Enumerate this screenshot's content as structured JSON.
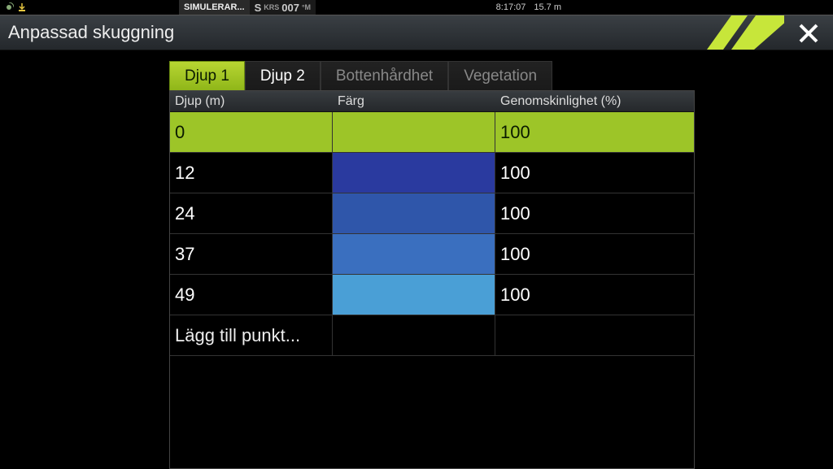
{
  "status": {
    "simulation_label": "SIMULERAR...",
    "heading_prefix": "S",
    "heading_label": "KRS",
    "heading_value": "007",
    "heading_unit": "°M",
    "time": "8:17:07",
    "depth": "15.7 m"
  },
  "title": "Anpassad skuggning",
  "accent_color": "#c7e63a",
  "tabs": [
    {
      "label": "Djup 1",
      "active": true
    },
    {
      "label": "Djup 2",
      "active": false
    },
    {
      "label": "Bottenhårdhet",
      "active": false
    },
    {
      "label": "Vegetation",
      "active": false
    }
  ],
  "columns": {
    "depth": "Djup (m)",
    "color": "Färg",
    "transparency": "Genomskinlighet (%)"
  },
  "rows": [
    {
      "depth": "0",
      "color": "#9dc528",
      "transparency": "100"
    },
    {
      "depth": "12",
      "color": "#2a3a9f",
      "transparency": "100"
    },
    {
      "depth": "24",
      "color": "#2f56aa",
      "transparency": "100"
    },
    {
      "depth": "37",
      "color": "#3a6fbf",
      "transparency": "100"
    },
    {
      "depth": "49",
      "color": "#4a9fd6",
      "transparency": "100"
    }
  ],
  "add_point_label": "Lägg till punkt..."
}
